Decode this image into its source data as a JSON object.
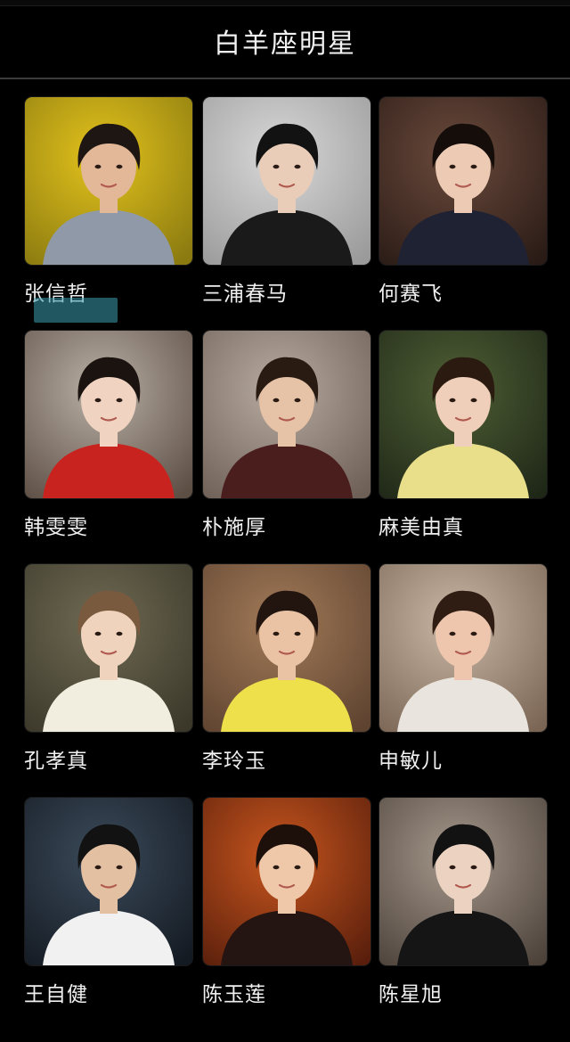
{
  "header": {
    "title": "白羊座明星"
  },
  "stars": [
    {
      "name": "张信哲",
      "bg": "#e3c21c",
      "bg2": "#8a7a10",
      "skin": "#e2b899",
      "hair": "#1d1612",
      "cloth": "#8f99a8",
      "icon": "person-photo-icon"
    },
    {
      "name": "三浦春马",
      "bg": "#d8d8d8",
      "bg2": "#9a9a9a",
      "skin": "#e9cdb8",
      "hair": "#121212",
      "cloth": "#1a1a1a",
      "icon": "person-photo-icon"
    },
    {
      "name": "何赛飞",
      "bg": "#6b4a3c",
      "bg2": "#2a1b16",
      "skin": "#eccab4",
      "hair": "#140d0a",
      "cloth": "#1f2233",
      "icon": "person-photo-icon"
    },
    {
      "name": "韩雯雯",
      "bg": "#b9b0a6",
      "bg2": "#5d4e44",
      "skin": "#f0d3c1",
      "hair": "#1b1310",
      "cloth": "#c8231f",
      "icon": "person-photo-icon"
    },
    {
      "name": "朴施厚",
      "bg": "#b7aa9f",
      "bg2": "#6e6057",
      "skin": "#e6c2a7",
      "hair": "#2a1b12",
      "cloth": "#4a1e1c",
      "icon": "person-photo-icon"
    },
    {
      "name": "麻美由真",
      "bg": "#4f5f35",
      "bg2": "#1f2717",
      "skin": "#efcfb9",
      "hair": "#2b1a10",
      "cloth": "#e9df8a",
      "icon": "person-photo-icon"
    },
    {
      "name": "孔孝真",
      "bg": "#6f6a53",
      "bg2": "#3b382a",
      "skin": "#f0d3bd",
      "hair": "#7a5a3e",
      "cloth": "#f1eee0",
      "icon": "person-photo-icon"
    },
    {
      "name": "李玲玉",
      "bg": "#a27a58",
      "bg2": "#5e4330",
      "skin": "#e9c3a3",
      "hair": "#22150f",
      "cloth": "#ede04a",
      "icon": "person-photo-icon"
    },
    {
      "name": "申敏儿",
      "bg": "#c9b7a6",
      "bg2": "#7b6655",
      "skin": "#edc6ad",
      "hair": "#2f1c12",
      "cloth": "#e9e5de",
      "icon": "person-photo-icon"
    },
    {
      "name": "王自健",
      "bg": "#3b4a5a",
      "bg2": "#141a22",
      "skin": "#e4c0a3",
      "hair": "#121212",
      "cloth": "#f1f1f1",
      "icon": "person-photo-icon"
    },
    {
      "name": "陈玉莲",
      "bg": "#c8561e",
      "bg2": "#5a1f0c",
      "skin": "#efc8a9",
      "hair": "#1d100b",
      "cloth": "#241412",
      "icon": "person-photo-icon"
    },
    {
      "name": "陈星旭",
      "bg": "#a5978b",
      "bg2": "#4d433b",
      "skin": "#ecd2c1",
      "hair": "#121212",
      "cloth": "#151515",
      "icon": "person-photo-icon"
    }
  ]
}
